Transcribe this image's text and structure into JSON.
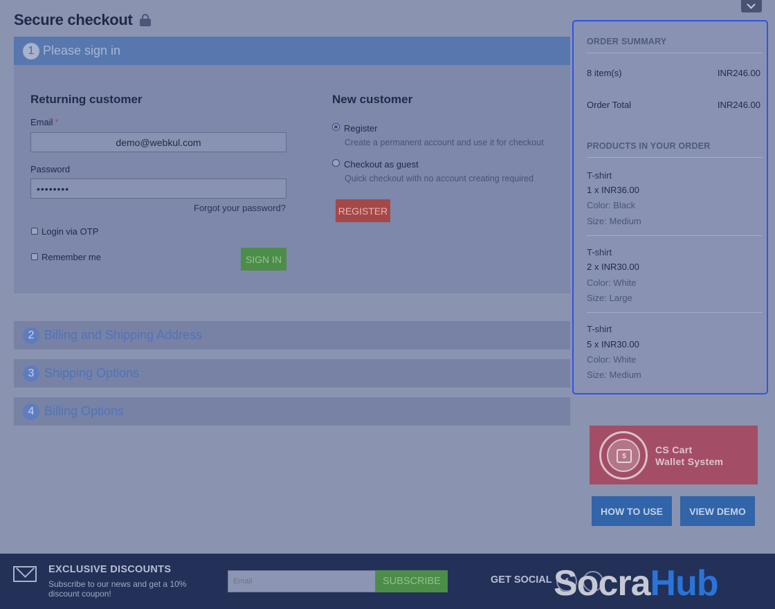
{
  "page": {
    "title": "Secure checkout"
  },
  "steps": [
    {
      "number": "1",
      "title": "Please sign in"
    },
    {
      "number": "2",
      "title": "Billing and Shipping Address"
    },
    {
      "number": "3",
      "title": "Shipping Options"
    },
    {
      "number": "4",
      "title": "Billing Options"
    }
  ],
  "returning": {
    "heading": "Returning customer",
    "email_label": "Email",
    "required_mark": "*",
    "email_value": "demo@webkul.com",
    "password_label": "Password",
    "password_value": "••••••••",
    "forgot": "Forgot your password?",
    "otp_label": "Login via OTP",
    "remember_label": "Remember me",
    "signin_button": "SIGN IN"
  },
  "newcustomer": {
    "heading": "New customer",
    "register_label": "Register",
    "register_hint": "Create a permanent account and use it for checkout",
    "guest_label": "Checkout as guest",
    "guest_hint": "Quick checkout with no account creating required",
    "register_button": "REGISTER"
  },
  "summary": {
    "heading": "ORDER SUMMARY",
    "items_label": "8 item(s)",
    "items_value": "INR246.00",
    "total_label": "Order Total",
    "total_value": "INR246.00",
    "products_heading": "PRODUCTS IN YOUR ORDER",
    "products": [
      {
        "name": "T-shirt",
        "qty": "1 x INR36.00",
        "color": "Color: Black",
        "size": "Size: Medium"
      },
      {
        "name": "T-shirt",
        "qty": "2 x INR30.00",
        "color": "Color: White",
        "size": "Size: Large"
      },
      {
        "name": "T-shirt",
        "qty": "5 x INR30.00",
        "color": "Color: White",
        "size": "Size: Medium"
      }
    ]
  },
  "promo": {
    "line1": "CS Cart",
    "line2": "Wallet System",
    "how_to_use": "HOW TO USE",
    "view_demo": "VIEW DEMO"
  },
  "footer": {
    "title": "EXCLUSIVE DISCOUNTS",
    "text": "Subscribe to our news and get a 10% discount coupon!",
    "email_placeholder": "Email",
    "subscribe_button": "SUBSCRIBE",
    "get_social": "GET SOCIAL",
    "brand_part1": "Socra",
    "brand_part2": "Hub"
  },
  "icons": {
    "lock": "lock-icon",
    "chevron": "chevron-down-icon",
    "mail": "mail-icon",
    "facebook": "facebook-icon",
    "twitter": "twitter-icon"
  },
  "colors": {
    "accent": "#2f53e6",
    "signin_green": "#4c8d49",
    "register_red": "#a54848",
    "step_blue": "#5777ae"
  }
}
